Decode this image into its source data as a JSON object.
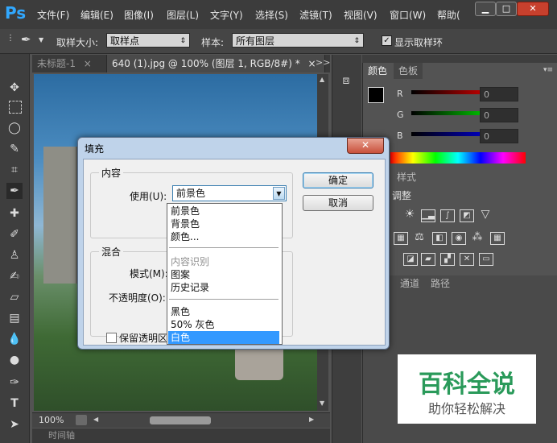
{
  "app": {
    "logo": "Ps",
    "menu": [
      "文件(F)",
      "编辑(E)",
      "图像(I)",
      "图层(L)",
      "文字(Y)",
      "选择(S)",
      "滤镜(T)",
      "视图(V)",
      "窗口(W)",
      "帮助("
    ],
    "window_buttons": {
      "minimize": "▁",
      "restore": "□",
      "close": "✕"
    }
  },
  "options": {
    "sample_size_label": "取样大小:",
    "sample_size_value": "取样点",
    "sample_label": "样本:",
    "sample_value": "所有图层",
    "show_ring_label": "显示取样环",
    "show_ring_checked": true
  },
  "tabs": [
    {
      "label": "未标题-1",
      "close": "×"
    },
    {
      "label": "640 (1).jpg @ 100% (图层 1, RGB/8#) *",
      "close": "×"
    }
  ],
  "tabs_overflow": ">>",
  "status": {
    "zoom": "100%"
  },
  "timeline_label": "时间轴",
  "panels": {
    "color_tab": "颜色",
    "swatches_tab": "色板",
    "sliders": [
      {
        "label": "R",
        "value": "0",
        "color": "#ff0000"
      },
      {
        "label": "G",
        "value": "0",
        "color": "#00ff00"
      },
      {
        "label": "B",
        "value": "0",
        "color": "#0000ff"
      }
    ],
    "styles_tab": "样式",
    "adjust_label": "调整",
    "channels_tab": "通道",
    "paths_tab": "路径"
  },
  "dialog": {
    "title": "填充",
    "close": "✕",
    "content_group": "内容",
    "use_label": "使用(U):",
    "use_value": "前景色",
    "blend_group": "混合",
    "mode_label": "模式(M):",
    "opacity_label": "不透明度(O):",
    "preserve_label": "保留透明区域",
    "ok_label": "确定",
    "cancel_label": "取消",
    "options": [
      {
        "label": "前景色",
        "state": "normal"
      },
      {
        "label": "背景色",
        "state": "normal"
      },
      {
        "label": "颜色...",
        "state": "normal"
      },
      {
        "label": "内容识别",
        "state": "disabled"
      },
      {
        "label": "图案",
        "state": "normal"
      },
      {
        "label": "历史记录",
        "state": "normal"
      },
      {
        "label": "黑色",
        "state": "normal"
      },
      {
        "label": "50% 灰色",
        "state": "normal"
      },
      {
        "label": "白色",
        "state": "selected"
      }
    ]
  },
  "watermark": {
    "title": "百科全说",
    "subtitle": "助你轻松解决"
  }
}
